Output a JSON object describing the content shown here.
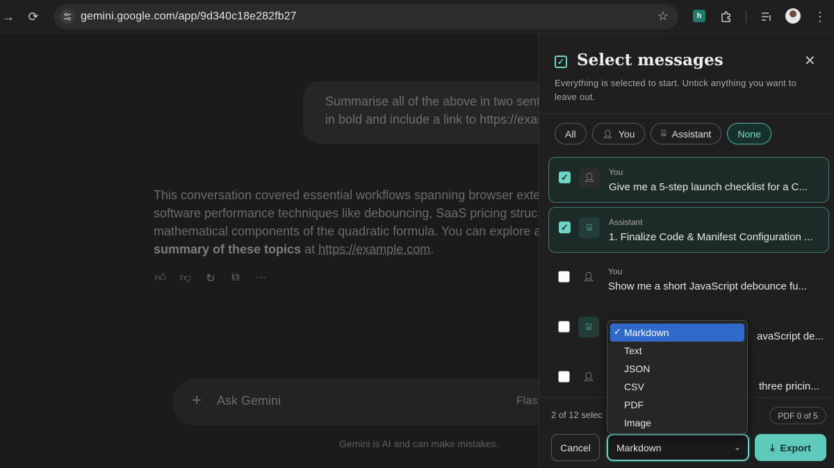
{
  "browser": {
    "url": "gemini.google.com/app/9d340c18e282fb27",
    "ext_badge": "h"
  },
  "chat": {
    "user_message_lines": "Summarise all of the above in two sent\nin bold and include a link to https://exar",
    "answer_line1": "This conversation covered essential workflows spanning browser exte",
    "answer_line2": "software performance techniques like debouncing, SaaS pricing struc",
    "answer_line3": "mathematical components of the quadratic formula. You can explore a",
    "answer_bold": "summary of these topics",
    "answer_at": " at ",
    "answer_link": "https://example.com",
    "answer_end": ".",
    "ask_placeholder": "Ask Gemini",
    "model_label": "Flas",
    "disclaimer": "Gemini is AI and can make mistakes."
  },
  "panel": {
    "title": "Select messages",
    "subtitle": "Everything is selected to start. Untick anything you want to leave out.",
    "filters": [
      {
        "label": "All"
      },
      {
        "label": "You"
      },
      {
        "label": "Assistant"
      },
      {
        "label": "None"
      }
    ],
    "messages": [
      {
        "role": "You",
        "text": "Give me a 5-step launch checklist for a C...",
        "checked": true
      },
      {
        "role": "Assistant",
        "text": "1. Finalize Code & Manifest Configuration ...",
        "checked": true
      },
      {
        "role": "You",
        "text": "Show me a short JavaScript debounce fu...",
        "checked": false
      },
      {
        "role": "",
        "text": "avaScript de...",
        "checked": false
      },
      {
        "role": "",
        "text": "three pricin...",
        "checked": false
      }
    ],
    "selected_count": "2 of 12 selec",
    "pdf_badge": "PDF 0 of 5",
    "cancel_label": "Cancel",
    "format_value": "Markdown",
    "export_label": "Export"
  },
  "format_options": [
    {
      "label": "Markdown",
      "selected": true
    },
    {
      "label": "Text"
    },
    {
      "label": "JSON"
    },
    {
      "label": "CSV"
    },
    {
      "label": "PDF"
    },
    {
      "label": "Image"
    }
  ],
  "colors": {
    "accent": "#6fd4c6",
    "highlight": "#2f69c9"
  }
}
